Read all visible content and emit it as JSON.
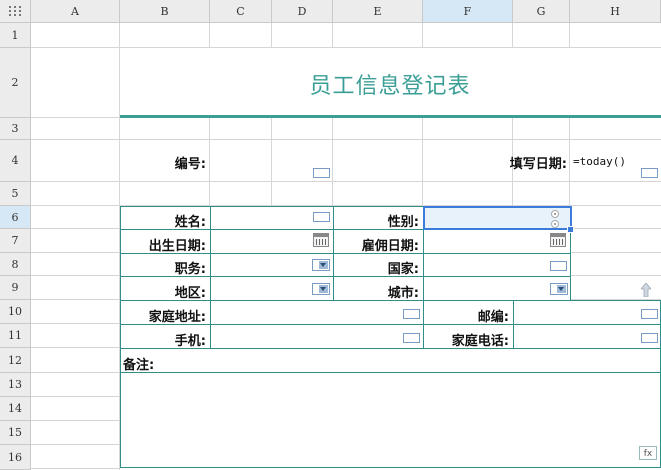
{
  "columns": [
    "A",
    "B",
    "C",
    "D",
    "E",
    "F",
    "G",
    "H"
  ],
  "rows": [
    "1",
    "2",
    "3",
    "4",
    "5",
    "6",
    "7",
    "8",
    "9",
    "10",
    "11",
    "12",
    "13",
    "14",
    "15",
    "16"
  ],
  "corner_icon": "select-all-grid-icon",
  "form": {
    "title": "员工信息登记表",
    "number_label": "编号:",
    "fill_date_label": "填写日期:",
    "fill_date_formula": "=today()",
    "name_label": "姓名:",
    "gender_label": "性别:",
    "birth_label": "出生日期:",
    "hire_label": "雇佣日期:",
    "position_label": "职务:",
    "country_label": "国家:",
    "region_label": "地区:",
    "city_label": "城市:",
    "address_label": "家庭地址:",
    "zip_label": "邮编:",
    "mobile_label": "手机:",
    "home_phone_label": "家庭电话:",
    "notes_label": "备注:",
    "fx_label": "fx"
  },
  "colors": {
    "accent": "#3a9e96",
    "header_bg": "#ececec",
    "selection": "#3b7bd9"
  }
}
